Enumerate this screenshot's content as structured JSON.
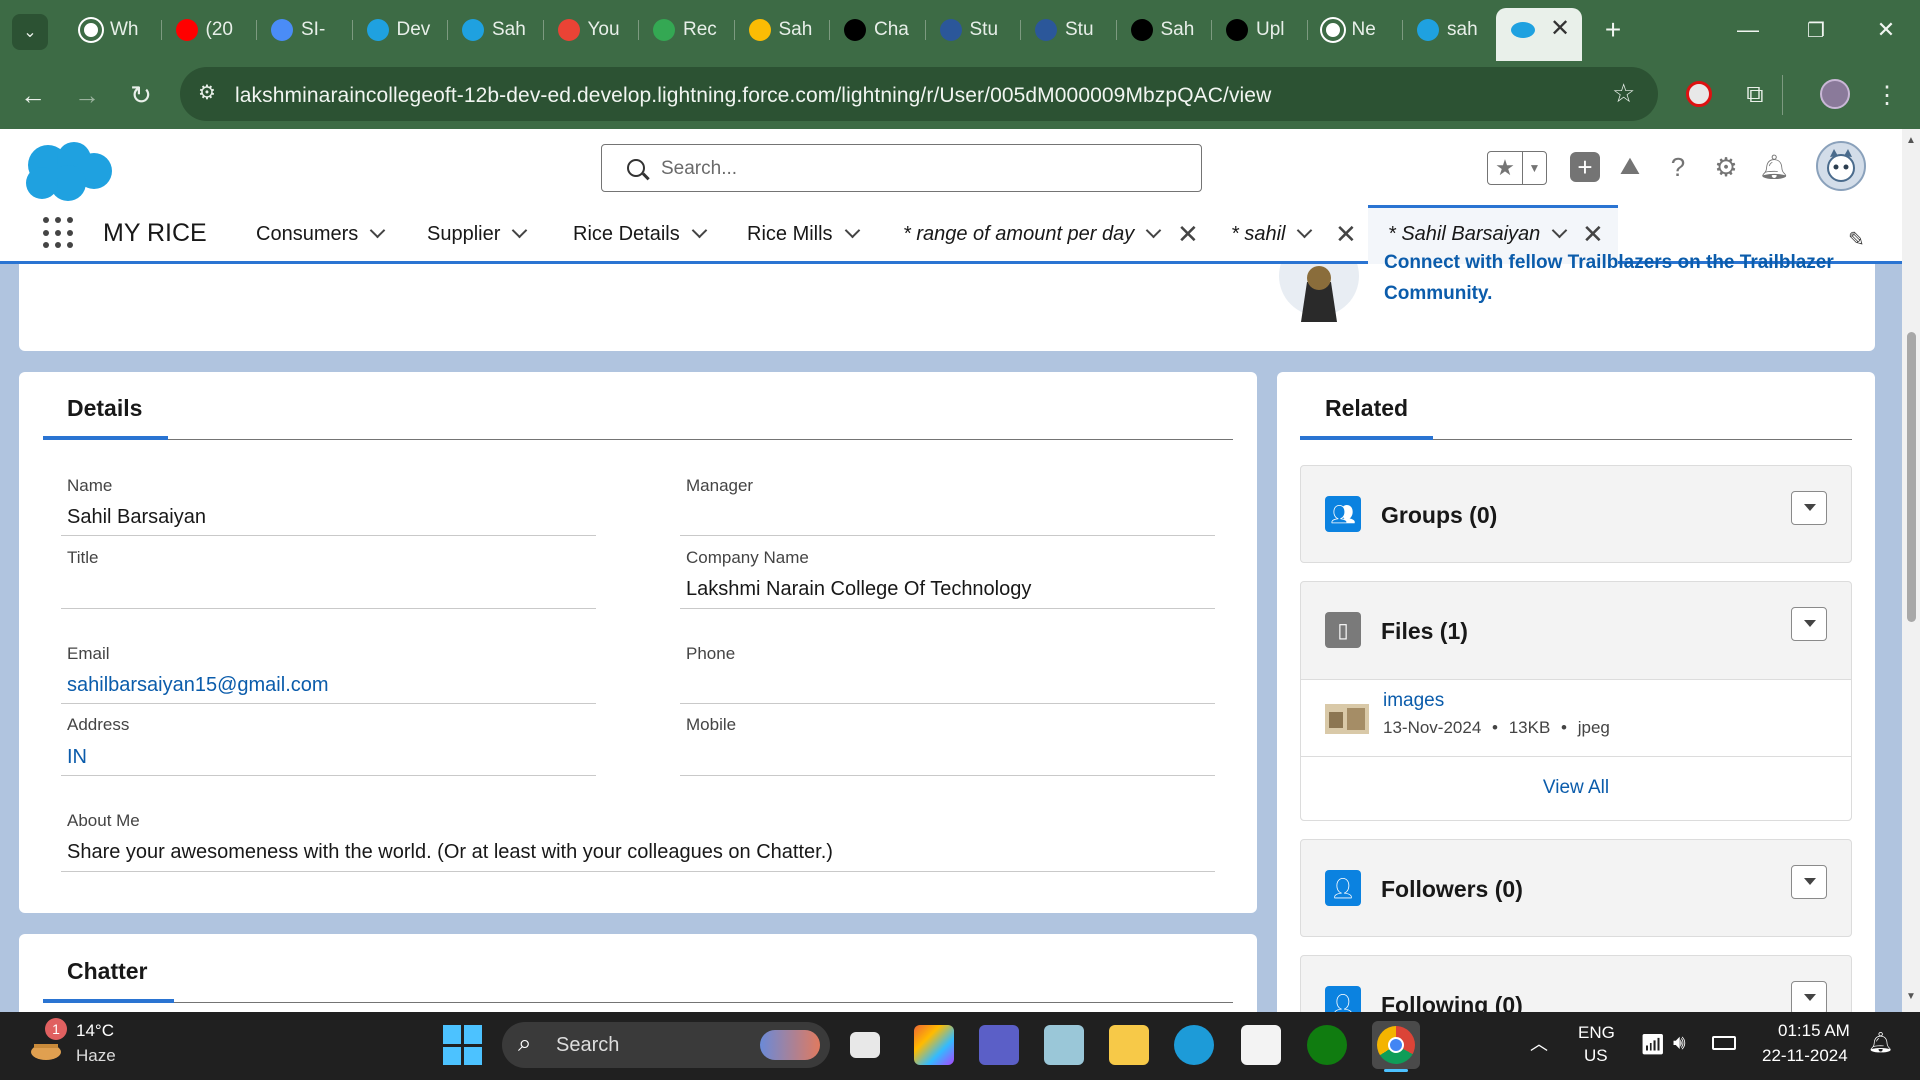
{
  "browser": {
    "tabs": [
      {
        "label": "Wh",
        "icon": "chrome-icon",
        "color": "#ffffff"
      },
      {
        "label": "(20",
        "icon": "youtube-icon",
        "color": "#ff0000"
      },
      {
        "label": "SI-",
        "icon": "form-icon",
        "color": "#4a8cf7"
      },
      {
        "label": "Dev",
        "icon": "salesforce-icon",
        "color": "#1fa1e0"
      },
      {
        "label": "Sah",
        "icon": "salesforce-icon",
        "color": "#1fa1e0"
      },
      {
        "label": "You",
        "icon": "gmail-icon",
        "color": "#ea4335"
      },
      {
        "label": "Rec",
        "icon": "drive-icon",
        "color": "#34a853"
      },
      {
        "label": "Sah",
        "icon": "drive-icon",
        "color": "#fbbc04"
      },
      {
        "label": "Cha",
        "icon": "chatgpt-icon",
        "color": "#000000"
      },
      {
        "label": "Stu",
        "icon": "studio-icon",
        "color": "#2b579a"
      },
      {
        "label": "Stu",
        "icon": "studio-icon",
        "color": "#2b579a"
      },
      {
        "label": "Sah",
        "icon": "chatgpt-icon",
        "color": "#000000"
      },
      {
        "label": "Upl",
        "icon": "github-icon",
        "color": "#000000"
      },
      {
        "label": "Ne",
        "icon": "chrome-icon",
        "color": "#ffffff"
      },
      {
        "label": "sah",
        "icon": "salesforce-icon",
        "color": "#1fa1e0"
      }
    ],
    "new_tab": "+",
    "url": "lakshminaraincollegeoft-12b-dev-ed.develop.lightning.force.com/lightning/r/User/005dM000009MbzpQAC/view"
  },
  "sf": {
    "search_placeholder": "Search...",
    "app_name": "MY RICE",
    "nav": [
      {
        "label": "Consumers"
      },
      {
        "label": "Supplier"
      },
      {
        "label": "Rice Details"
      },
      {
        "label": "Rice Mills"
      }
    ],
    "workspace_tabs": [
      {
        "label": "* range of amount per day"
      },
      {
        "label": "* sahil"
      },
      {
        "label": "* Sahil Barsaiyan"
      }
    ],
    "accent": "#2a74d2"
  },
  "banner": {
    "line1": "Connect with fellow Trailblazers on the Trailblazer",
    "line2": "Community."
  },
  "details": {
    "heading": "Details",
    "fields": {
      "name_label": "Name",
      "name_value": "Sahil Barsaiyan",
      "manager_label": "Manager",
      "manager_value": "",
      "title_label": "Title",
      "title_value": "",
      "company_label": "Company Name",
      "company_value": "Lakshmi Narain College Of Technology",
      "email_label": "Email",
      "email_value": "sahilbarsaiyan15@gmail.com",
      "phone_label": "Phone",
      "phone_value": "",
      "address_label": "Address",
      "address_value": "IN",
      "mobile_label": "Mobile",
      "mobile_value": "",
      "about_label": "About Me",
      "about_value": "Share your awesomeness with the world. (Or at least with your colleagues on Chatter.)"
    }
  },
  "chatter": {
    "heading": "Chatter"
  },
  "related": {
    "heading": "Related",
    "groups_title": "Groups (0)",
    "files_title": "Files (1)",
    "file": {
      "name": "images",
      "date": "13-Nov-2024",
      "size": "13KB",
      "type": "jpeg"
    },
    "view_all": "View All",
    "followers_title": "Followers (0)",
    "following_title": "Following (0)",
    "groups_color": "#0b82e0",
    "files_color": "#7a7a7a"
  },
  "taskbar": {
    "weather_temp": "14°C",
    "weather_desc": "Haze",
    "weather_badge": "1",
    "search_label": "Search",
    "lang1": "ENG",
    "lang2": "US",
    "time": "01:15 AM",
    "date": "22-11-2024"
  }
}
